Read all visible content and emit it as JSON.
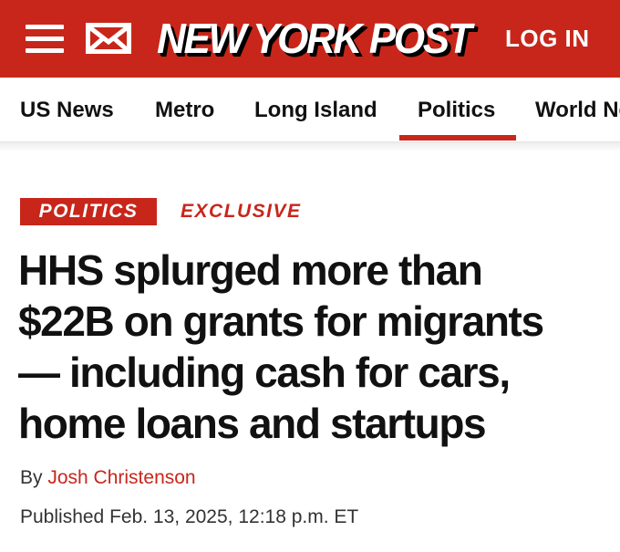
{
  "header": {
    "logo_text": "NEW YORK POST",
    "login_label": "LOG IN",
    "menu_icon": "hamburger-menu-icon",
    "mail_icon": "envelope-icon",
    "background_color": "#c8261b"
  },
  "nav": {
    "items": [
      {
        "label": "US News"
      },
      {
        "label": "Metro"
      },
      {
        "label": "Long Island"
      },
      {
        "label": "Politics",
        "active": true
      },
      {
        "label": "World News"
      }
    ]
  },
  "article": {
    "section_tag": "POLITICS",
    "exclusive_tag": "EXCLUSIVE",
    "headline_lines": [
      "HHS splurged more than",
      "$22B on grants for migrants",
      "— including cash for cars,",
      "home loans and startups"
    ],
    "byline_prefix": "By",
    "author": "Josh Christenson",
    "published": "Published Feb. 13, 2025, 12:18 p.m. ET"
  },
  "colors": {
    "brand_red": "#c8261b",
    "text": "#111111"
  }
}
